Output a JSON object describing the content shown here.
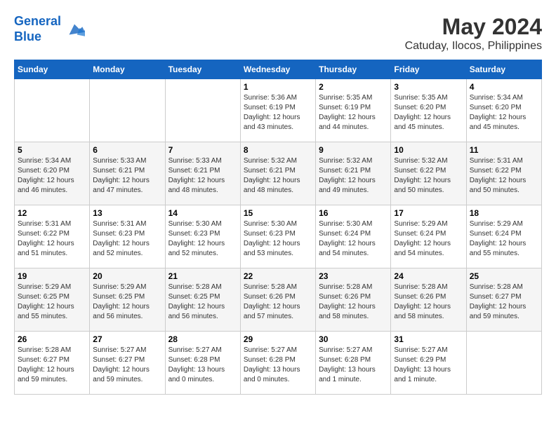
{
  "logo": {
    "line1": "General",
    "line2": "Blue"
  },
  "title": "May 2024",
  "subtitle": "Catuday, Ilocos, Philippines",
  "days_of_week": [
    "Sunday",
    "Monday",
    "Tuesday",
    "Wednesday",
    "Thursday",
    "Friday",
    "Saturday"
  ],
  "weeks": [
    [
      {
        "day": "",
        "info": ""
      },
      {
        "day": "",
        "info": ""
      },
      {
        "day": "",
        "info": ""
      },
      {
        "day": "1",
        "info": "Sunrise: 5:36 AM\nSunset: 6:19 PM\nDaylight: 12 hours and 43 minutes."
      },
      {
        "day": "2",
        "info": "Sunrise: 5:35 AM\nSunset: 6:19 PM\nDaylight: 12 hours and 44 minutes."
      },
      {
        "day": "3",
        "info": "Sunrise: 5:35 AM\nSunset: 6:20 PM\nDaylight: 12 hours and 45 minutes."
      },
      {
        "day": "4",
        "info": "Sunrise: 5:34 AM\nSunset: 6:20 PM\nDaylight: 12 hours and 45 minutes."
      }
    ],
    [
      {
        "day": "5",
        "info": "Sunrise: 5:34 AM\nSunset: 6:20 PM\nDaylight: 12 hours and 46 minutes."
      },
      {
        "day": "6",
        "info": "Sunrise: 5:33 AM\nSunset: 6:21 PM\nDaylight: 12 hours and 47 minutes."
      },
      {
        "day": "7",
        "info": "Sunrise: 5:33 AM\nSunset: 6:21 PM\nDaylight: 12 hours and 48 minutes."
      },
      {
        "day": "8",
        "info": "Sunrise: 5:32 AM\nSunset: 6:21 PM\nDaylight: 12 hours and 48 minutes."
      },
      {
        "day": "9",
        "info": "Sunrise: 5:32 AM\nSunset: 6:21 PM\nDaylight: 12 hours and 49 minutes."
      },
      {
        "day": "10",
        "info": "Sunrise: 5:32 AM\nSunset: 6:22 PM\nDaylight: 12 hours and 50 minutes."
      },
      {
        "day": "11",
        "info": "Sunrise: 5:31 AM\nSunset: 6:22 PM\nDaylight: 12 hours and 50 minutes."
      }
    ],
    [
      {
        "day": "12",
        "info": "Sunrise: 5:31 AM\nSunset: 6:22 PM\nDaylight: 12 hours and 51 minutes."
      },
      {
        "day": "13",
        "info": "Sunrise: 5:31 AM\nSunset: 6:23 PM\nDaylight: 12 hours and 52 minutes."
      },
      {
        "day": "14",
        "info": "Sunrise: 5:30 AM\nSunset: 6:23 PM\nDaylight: 12 hours and 52 minutes."
      },
      {
        "day": "15",
        "info": "Sunrise: 5:30 AM\nSunset: 6:23 PM\nDaylight: 12 hours and 53 minutes."
      },
      {
        "day": "16",
        "info": "Sunrise: 5:30 AM\nSunset: 6:24 PM\nDaylight: 12 hours and 54 minutes."
      },
      {
        "day": "17",
        "info": "Sunrise: 5:29 AM\nSunset: 6:24 PM\nDaylight: 12 hours and 54 minutes."
      },
      {
        "day": "18",
        "info": "Sunrise: 5:29 AM\nSunset: 6:24 PM\nDaylight: 12 hours and 55 minutes."
      }
    ],
    [
      {
        "day": "19",
        "info": "Sunrise: 5:29 AM\nSunset: 6:25 PM\nDaylight: 12 hours and 55 minutes."
      },
      {
        "day": "20",
        "info": "Sunrise: 5:29 AM\nSunset: 6:25 PM\nDaylight: 12 hours and 56 minutes."
      },
      {
        "day": "21",
        "info": "Sunrise: 5:28 AM\nSunset: 6:25 PM\nDaylight: 12 hours and 56 minutes."
      },
      {
        "day": "22",
        "info": "Sunrise: 5:28 AM\nSunset: 6:26 PM\nDaylight: 12 hours and 57 minutes."
      },
      {
        "day": "23",
        "info": "Sunrise: 5:28 AM\nSunset: 6:26 PM\nDaylight: 12 hours and 58 minutes."
      },
      {
        "day": "24",
        "info": "Sunrise: 5:28 AM\nSunset: 6:26 PM\nDaylight: 12 hours and 58 minutes."
      },
      {
        "day": "25",
        "info": "Sunrise: 5:28 AM\nSunset: 6:27 PM\nDaylight: 12 hours and 59 minutes."
      }
    ],
    [
      {
        "day": "26",
        "info": "Sunrise: 5:28 AM\nSunset: 6:27 PM\nDaylight: 12 hours and 59 minutes."
      },
      {
        "day": "27",
        "info": "Sunrise: 5:27 AM\nSunset: 6:27 PM\nDaylight: 12 hours and 59 minutes."
      },
      {
        "day": "28",
        "info": "Sunrise: 5:27 AM\nSunset: 6:28 PM\nDaylight: 13 hours and 0 minutes."
      },
      {
        "day": "29",
        "info": "Sunrise: 5:27 AM\nSunset: 6:28 PM\nDaylight: 13 hours and 0 minutes."
      },
      {
        "day": "30",
        "info": "Sunrise: 5:27 AM\nSunset: 6:28 PM\nDaylight: 13 hours and 1 minute."
      },
      {
        "day": "31",
        "info": "Sunrise: 5:27 AM\nSunset: 6:29 PM\nDaylight: 13 hours and 1 minute."
      },
      {
        "day": "",
        "info": ""
      }
    ]
  ]
}
